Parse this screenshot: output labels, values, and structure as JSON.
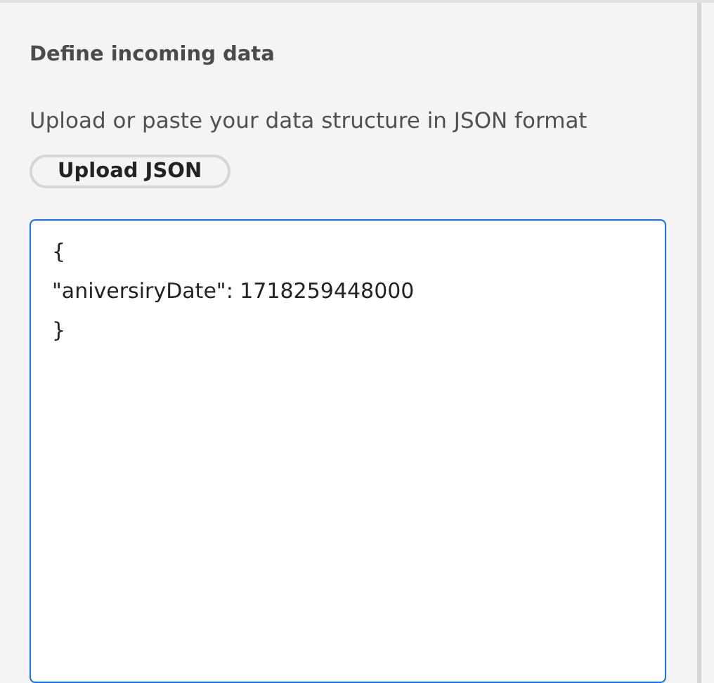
{
  "section": {
    "title": "Define incoming data",
    "description": "Upload or paste your data structure in JSON format"
  },
  "upload_button": {
    "label": "Upload JSON"
  },
  "json_editor": {
    "value": "{\n\"aniversiryDate\": 1718259448000\n}"
  }
}
